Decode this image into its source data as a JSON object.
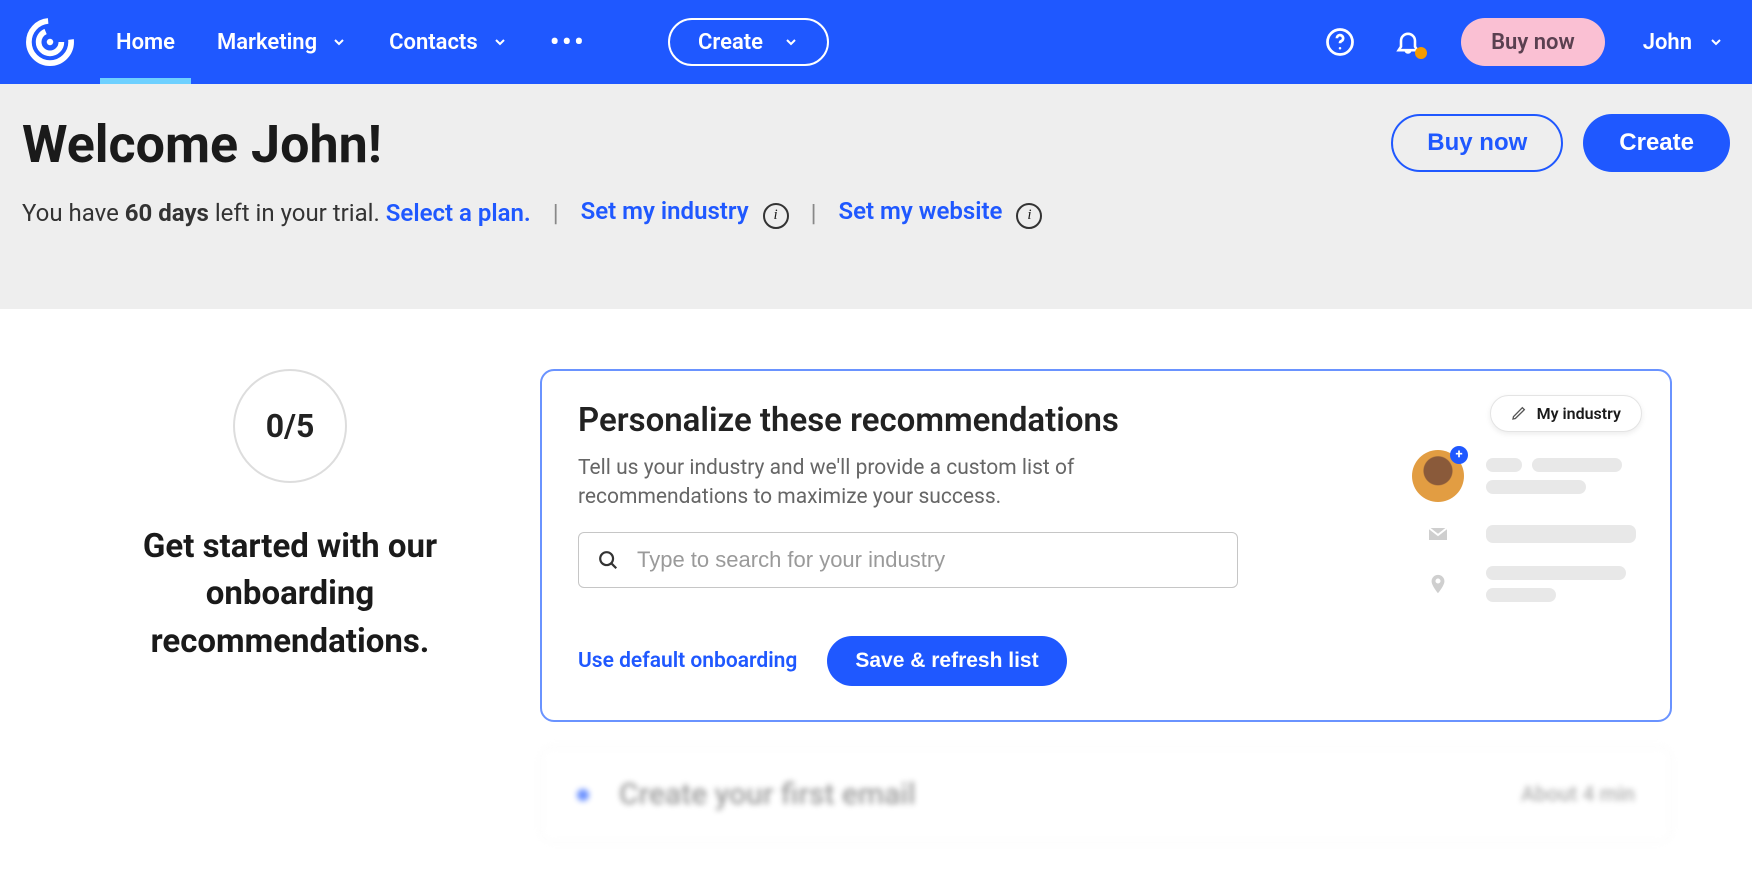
{
  "nav": {
    "items": [
      "Home",
      "Marketing",
      "Contacts"
    ],
    "create": "Create",
    "buy": "Buy now",
    "user": "John"
  },
  "hero": {
    "title": "Welcome John!",
    "trial_prefix": "You have ",
    "trial_days": "60 days",
    "trial_suffix": " left in your trial. ",
    "select_plan": "Select a plan.",
    "set_industry": "Set my industry",
    "set_website": "Set my website",
    "buy": "Buy now",
    "create": "Create"
  },
  "sidebar": {
    "progress": "0/5",
    "title": "Get started with our onboarding recommendations."
  },
  "card": {
    "title": "Personalize these recommendations",
    "subtitle": "Tell us your industry and we'll provide a custom list of recommendations to maximize your success.",
    "placeholder": "Type to search for your industry",
    "default_link": "Use default onboarding",
    "save": "Save & refresh list",
    "chip": "My industry"
  },
  "next": {
    "title": "Create your first email",
    "meta": "About 4 min"
  }
}
